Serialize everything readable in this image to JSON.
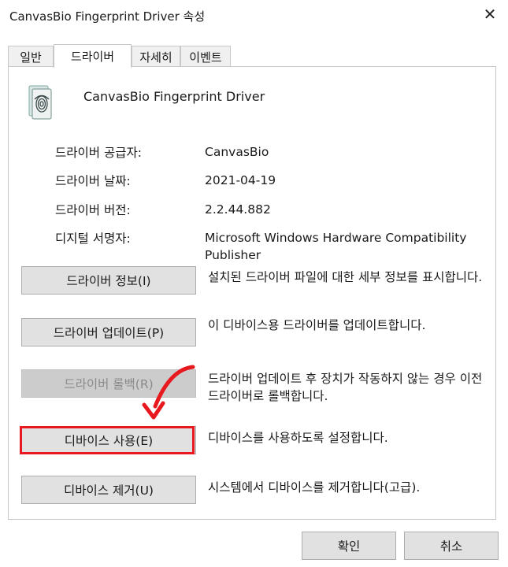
{
  "window": {
    "title": "CanvasBio Fingerprint Driver 속성",
    "close_label": "✕"
  },
  "tabs": [
    {
      "label": "일반",
      "active": false
    },
    {
      "label": "드라이버",
      "active": true
    },
    {
      "label": "자세히",
      "active": false
    },
    {
      "label": "이벤트",
      "active": false
    }
  ],
  "device": {
    "name": "CanvasBio Fingerprint Driver",
    "icon": "fingerprint-icon"
  },
  "info": [
    {
      "label": "드라이버 공급자:",
      "value": "CanvasBio"
    },
    {
      "label": "드라이버 날짜:",
      "value": "2021-04-19"
    },
    {
      "label": "드라이버 버전:",
      "value": "2.2.44.882"
    },
    {
      "label": "디지털 서명자:",
      "value": "Microsoft Windows Hardware Compatibility Publisher"
    }
  ],
  "actions": [
    {
      "button": "드라이버 정보(I)",
      "description": "설치된 드라이버 파일에 대한 세부 정보를 표시합니다.",
      "enabled": true
    },
    {
      "button": "드라이버 업데이트(P)",
      "description": "이 디바이스용 드라이버를 업데이트합니다.",
      "enabled": true
    },
    {
      "button": "드라이버 롤백(R)",
      "description": "드라이버 업데이트 후 장치가 작동하지 않는 경우 이전 드라이버로 롤백합니다.",
      "enabled": false
    },
    {
      "button": "디바이스 사용(E)",
      "description": "디바이스를 사용하도록 설정합니다.",
      "enabled": true,
      "highlighted": true
    },
    {
      "button": "디바이스 제거(U)",
      "description": "시스템에서 디바이스를 제거합니다(고급).",
      "enabled": true
    }
  ],
  "footer": {
    "ok_label": "확인",
    "cancel_label": "취소"
  },
  "annotation": {
    "highlight_color": "#e8191e"
  }
}
